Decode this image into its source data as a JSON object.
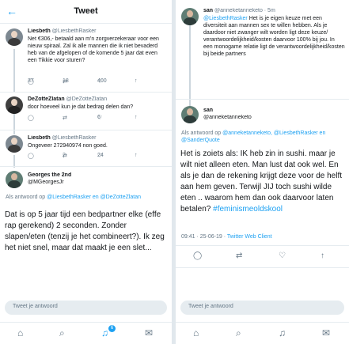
{
  "left": {
    "title": "Tweet",
    "back_icon": "back-arrow-icon",
    "tweets": [
      {
        "name": "Liesbeth",
        "handle": "@LiesbethRasker",
        "text": "Net €306,- betaald aan m'n zorgverzekeraar voor een nieuw spiraal. Zal ik alle mannen die ik niet bevaderd heb van de afgelopen of de komende 5 jaar dat even een Tikkie voor sturen?",
        "replies": "37",
        "retweets": "18",
        "likes": "400"
      },
      {
        "name": "DeZotteZlatan",
        "handle": "@DeZotteZlatan",
        "text": "door hoeveel kun je dat bedrag delen dan?",
        "replies": "",
        "retweets": "",
        "likes": "6"
      },
      {
        "name": "Liesbeth",
        "handle": "@LiesbethRasker",
        "text": "Ongeveer 272940974 non goed.",
        "replies": "",
        "retweets": "2",
        "likes": "24"
      }
    ],
    "main": {
      "name": "Georges the 2nd",
      "handle": "@MGeorgesJr",
      "reply_prefix": "Als antwoord op",
      "reply_mentions": "@LiesbethRasker en @DeZotteZlatan",
      "text": "Dat is op 5 jaar tijd een bedpartner elke (effe rap gerekend) 2 seconden. Zonder slapen/eten (tenzij je het combineert?). Ik zeg het niet snel, maar dat maakt je een slet..."
    },
    "reply_placeholder": "Tweet je antwoord",
    "notification_count": "6"
  },
  "right": {
    "top": {
      "name": "san",
      "handle": "@anneketanneketo · 5m",
      "mention": "@LiesbethRasker",
      "text": "Het is je eigen keuze met een diversiteit aan mannen sex te willen hebben. Als je daardoor niet zwanger wilt worden ligt deze keuze/ verantwoordelijkheid/kosten daarvoor 100% bij jou. In een monogame relatie ligt de verantwoordelijkheid/kosten bij beide partners"
    },
    "main": {
      "name": "san",
      "handle": "@anneketanneketo",
      "reply_prefix": "Als antwoord op",
      "reply_mentions": "@anneketanneketo, @LiesbethRasker en @SanderQuote",
      "text": "Het is zoiets als: IK heb zin in sushi. maar je wilt niet alleen eten. Man lust dat ook wel. En als je dan de rekening krijgt deze voor de helft aan hem geven. Terwijl JIJ toch sushi wilde eten .. waarom hem dan ook daarvoor laten betalen?",
      "hashtag": "#feminismeoldskool",
      "time": "09:41 · 25-06-19 ·",
      "source": "Twitter Web Client"
    },
    "reply_placeholder": "Tweet je antwoord"
  },
  "colors": {
    "accent": "#1da1f2",
    "muted": "#657786",
    "text": "#14171a",
    "divider": "#e6ecf0"
  }
}
